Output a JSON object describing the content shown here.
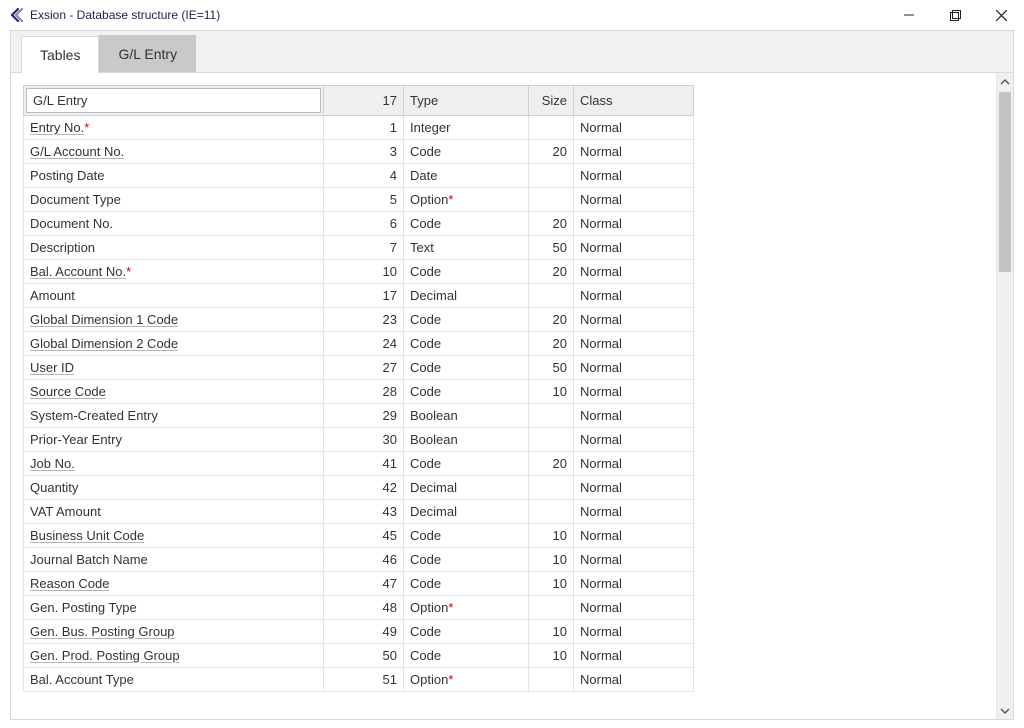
{
  "window": {
    "title": "Exsion - Database structure (IE=11)"
  },
  "tabs": [
    {
      "label": "Tables",
      "active": true
    },
    {
      "label": "G/L Entry",
      "active": false
    }
  ],
  "table": {
    "filter_value": "G/L Entry",
    "header": {
      "count": "17",
      "type": "Type",
      "size": "Size",
      "class": "Class"
    },
    "rows": [
      {
        "name": "Entry No.",
        "star": true,
        "link": true,
        "no": "1",
        "type": "Integer",
        "type_star": false,
        "size": "",
        "clazz": "Normal"
      },
      {
        "name": "G/L Account No.",
        "star": false,
        "link": true,
        "no": "3",
        "type": "Code",
        "type_star": false,
        "size": "20",
        "clazz": "Normal"
      },
      {
        "name": "Posting Date",
        "star": false,
        "link": false,
        "no": "4",
        "type": "Date",
        "type_star": false,
        "size": "",
        "clazz": "Normal"
      },
      {
        "name": "Document Type",
        "star": false,
        "link": false,
        "no": "5",
        "type": "Option",
        "type_star": true,
        "size": "",
        "clazz": "Normal"
      },
      {
        "name": "Document No.",
        "star": false,
        "link": false,
        "no": "6",
        "type": "Code",
        "type_star": false,
        "size": "20",
        "clazz": "Normal"
      },
      {
        "name": "Description",
        "star": false,
        "link": false,
        "no": "7",
        "type": "Text",
        "type_star": false,
        "size": "50",
        "clazz": "Normal"
      },
      {
        "name": "Bal. Account No.",
        "star": true,
        "link": true,
        "no": "10",
        "type": "Code",
        "type_star": false,
        "size": "20",
        "clazz": "Normal"
      },
      {
        "name": "Amount",
        "star": false,
        "link": false,
        "no": "17",
        "type": "Decimal",
        "type_star": false,
        "size": "",
        "clazz": "Normal"
      },
      {
        "name": "Global Dimension 1 Code",
        "star": false,
        "link": true,
        "no": "23",
        "type": "Code",
        "type_star": false,
        "size": "20",
        "clazz": "Normal"
      },
      {
        "name": "Global Dimension 2 Code",
        "star": false,
        "link": true,
        "no": "24",
        "type": "Code",
        "type_star": false,
        "size": "20",
        "clazz": "Normal"
      },
      {
        "name": "User ID",
        "star": false,
        "link": true,
        "no": "27",
        "type": "Code",
        "type_star": false,
        "size": "50",
        "clazz": "Normal"
      },
      {
        "name": "Source Code",
        "star": false,
        "link": true,
        "no": "28",
        "type": "Code",
        "type_star": false,
        "size": "10",
        "clazz": "Normal"
      },
      {
        "name": "System-Created Entry",
        "star": false,
        "link": false,
        "no": "29",
        "type": "Boolean",
        "type_star": false,
        "size": "",
        "clazz": "Normal"
      },
      {
        "name": "Prior-Year Entry",
        "star": false,
        "link": false,
        "no": "30",
        "type": "Boolean",
        "type_star": false,
        "size": "",
        "clazz": "Normal"
      },
      {
        "name": "Job No.",
        "star": false,
        "link": true,
        "no": "41",
        "type": "Code",
        "type_star": false,
        "size": "20",
        "clazz": "Normal"
      },
      {
        "name": "Quantity",
        "star": false,
        "link": false,
        "no": "42",
        "type": "Decimal",
        "type_star": false,
        "size": "",
        "clazz": "Normal"
      },
      {
        "name": "VAT Amount",
        "star": false,
        "link": false,
        "no": "43",
        "type": "Decimal",
        "type_star": false,
        "size": "",
        "clazz": "Normal"
      },
      {
        "name": "Business Unit Code",
        "star": false,
        "link": true,
        "no": "45",
        "type": "Code",
        "type_star": false,
        "size": "10",
        "clazz": "Normal"
      },
      {
        "name": "Journal Batch Name",
        "star": false,
        "link": false,
        "no": "46",
        "type": "Code",
        "type_star": false,
        "size": "10",
        "clazz": "Normal"
      },
      {
        "name": "Reason Code",
        "star": false,
        "link": true,
        "no": "47",
        "type": "Code",
        "type_star": false,
        "size": "10",
        "clazz": "Normal"
      },
      {
        "name": "Gen. Posting Type",
        "star": false,
        "link": false,
        "no": "48",
        "type": "Option",
        "type_star": true,
        "size": "",
        "clazz": "Normal"
      },
      {
        "name": "Gen. Bus. Posting Group",
        "star": false,
        "link": true,
        "no": "49",
        "type": "Code",
        "type_star": false,
        "size": "10",
        "clazz": "Normal"
      },
      {
        "name": "Gen. Prod. Posting Group",
        "star": false,
        "link": true,
        "no": "50",
        "type": "Code",
        "type_star": false,
        "size": "10",
        "clazz": "Normal"
      },
      {
        "name": "Bal. Account Type",
        "star": false,
        "link": false,
        "no": "51",
        "type": "Option",
        "type_star": true,
        "size": "",
        "clazz": "Normal"
      }
    ]
  }
}
